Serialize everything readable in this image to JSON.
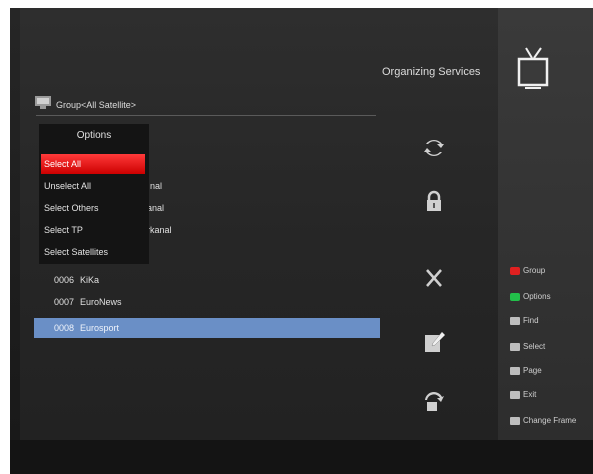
{
  "screen": {
    "title": "Organizing Services"
  },
  "group": {
    "label": "Group<All Satellite>"
  },
  "options_popup": {
    "title": "Options",
    "items": [
      "Select All",
      "Unselect All",
      "Select Others",
      "Select TP",
      "Select Satellites"
    ],
    "active_index": 0
  },
  "channels": {
    "partial_visible": [
      "nal",
      "anal",
      "rkanal"
    ],
    "rows": [
      {
        "num": "0006",
        "name": "KiKa"
      },
      {
        "num": "0007",
        "name": "EuroNews"
      },
      {
        "num": "0008",
        "name": "Eurosport"
      }
    ],
    "selected_index": 2
  },
  "action_icons": [
    "move-icon",
    "lock-icon",
    "delete-icon",
    "rename-icon",
    "sort-icon"
  ],
  "legend": [
    {
      "color": "#e02020",
      "label": "Group",
      "icon": "red-key-icon"
    },
    {
      "color": "#22c04a",
      "label": "Options",
      "icon": "green-key-icon"
    },
    {
      "color": "",
      "label": "Find",
      "icon": "find-key-icon"
    },
    {
      "color": "",
      "label": "Select",
      "icon": "select-key-icon"
    },
    {
      "color": "",
      "label": "Page",
      "icon": "page-key-icon"
    },
    {
      "color": "",
      "label": "Exit",
      "icon": "exit-key-icon"
    },
    {
      "color": "",
      "label": "Change Frame",
      "icon": "change-frame-key-icon"
    }
  ],
  "colors": {
    "selection": "#6a8fc6",
    "highlight": "#cc0000"
  }
}
